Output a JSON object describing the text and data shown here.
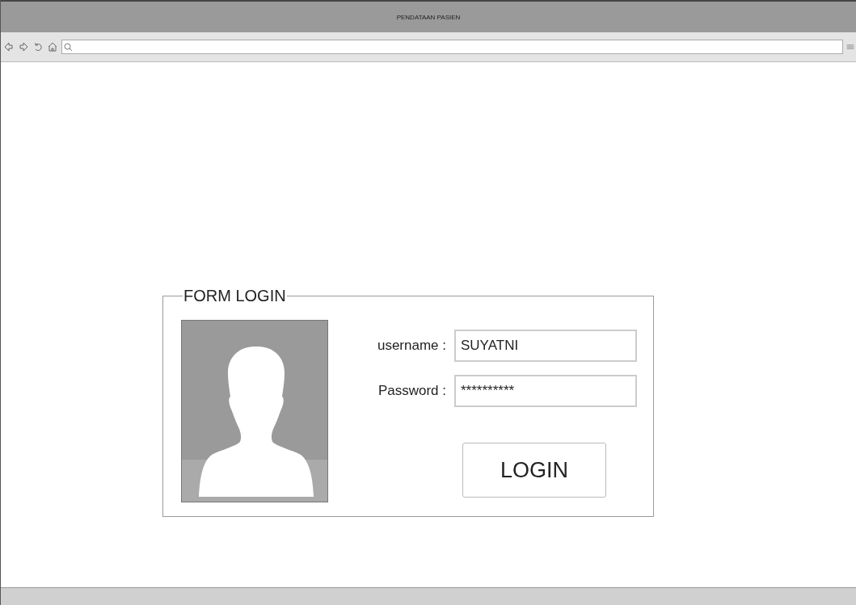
{
  "window": {
    "title": "PENDATAAN PASIEN"
  },
  "form": {
    "title": "FORM LOGIN",
    "fields": [
      {
        "label": "username :",
        "value": "SUYATNI"
      },
      {
        "label": "Password :",
        "value": "**********"
      }
    ],
    "button": "LOGIN"
  }
}
